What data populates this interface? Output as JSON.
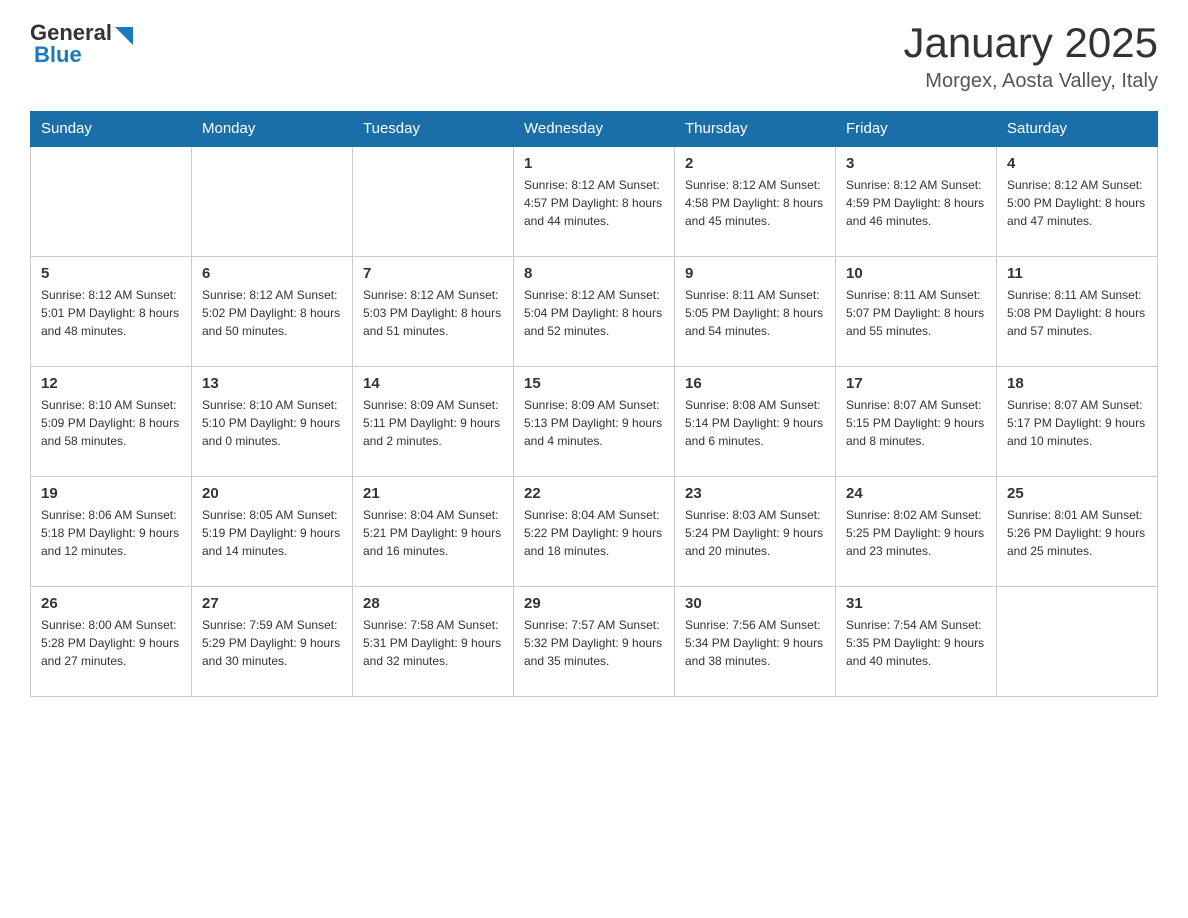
{
  "header": {
    "logo_general": "General",
    "logo_blue": "Blue",
    "title": "January 2025",
    "subtitle": "Morgex, Aosta Valley, Italy"
  },
  "days_of_week": [
    "Sunday",
    "Monday",
    "Tuesday",
    "Wednesday",
    "Thursday",
    "Friday",
    "Saturday"
  ],
  "weeks": [
    [
      {
        "day": "",
        "info": ""
      },
      {
        "day": "",
        "info": ""
      },
      {
        "day": "",
        "info": ""
      },
      {
        "day": "1",
        "info": "Sunrise: 8:12 AM\nSunset: 4:57 PM\nDaylight: 8 hours\nand 44 minutes."
      },
      {
        "day": "2",
        "info": "Sunrise: 8:12 AM\nSunset: 4:58 PM\nDaylight: 8 hours\nand 45 minutes."
      },
      {
        "day": "3",
        "info": "Sunrise: 8:12 AM\nSunset: 4:59 PM\nDaylight: 8 hours\nand 46 minutes."
      },
      {
        "day": "4",
        "info": "Sunrise: 8:12 AM\nSunset: 5:00 PM\nDaylight: 8 hours\nand 47 minutes."
      }
    ],
    [
      {
        "day": "5",
        "info": "Sunrise: 8:12 AM\nSunset: 5:01 PM\nDaylight: 8 hours\nand 48 minutes."
      },
      {
        "day": "6",
        "info": "Sunrise: 8:12 AM\nSunset: 5:02 PM\nDaylight: 8 hours\nand 50 minutes."
      },
      {
        "day": "7",
        "info": "Sunrise: 8:12 AM\nSunset: 5:03 PM\nDaylight: 8 hours\nand 51 minutes."
      },
      {
        "day": "8",
        "info": "Sunrise: 8:12 AM\nSunset: 5:04 PM\nDaylight: 8 hours\nand 52 minutes."
      },
      {
        "day": "9",
        "info": "Sunrise: 8:11 AM\nSunset: 5:05 PM\nDaylight: 8 hours\nand 54 minutes."
      },
      {
        "day": "10",
        "info": "Sunrise: 8:11 AM\nSunset: 5:07 PM\nDaylight: 8 hours\nand 55 minutes."
      },
      {
        "day": "11",
        "info": "Sunrise: 8:11 AM\nSunset: 5:08 PM\nDaylight: 8 hours\nand 57 minutes."
      }
    ],
    [
      {
        "day": "12",
        "info": "Sunrise: 8:10 AM\nSunset: 5:09 PM\nDaylight: 8 hours\nand 58 minutes."
      },
      {
        "day": "13",
        "info": "Sunrise: 8:10 AM\nSunset: 5:10 PM\nDaylight: 9 hours\nand 0 minutes."
      },
      {
        "day": "14",
        "info": "Sunrise: 8:09 AM\nSunset: 5:11 PM\nDaylight: 9 hours\nand 2 minutes."
      },
      {
        "day": "15",
        "info": "Sunrise: 8:09 AM\nSunset: 5:13 PM\nDaylight: 9 hours\nand 4 minutes."
      },
      {
        "day": "16",
        "info": "Sunrise: 8:08 AM\nSunset: 5:14 PM\nDaylight: 9 hours\nand 6 minutes."
      },
      {
        "day": "17",
        "info": "Sunrise: 8:07 AM\nSunset: 5:15 PM\nDaylight: 9 hours\nand 8 minutes."
      },
      {
        "day": "18",
        "info": "Sunrise: 8:07 AM\nSunset: 5:17 PM\nDaylight: 9 hours\nand 10 minutes."
      }
    ],
    [
      {
        "day": "19",
        "info": "Sunrise: 8:06 AM\nSunset: 5:18 PM\nDaylight: 9 hours\nand 12 minutes."
      },
      {
        "day": "20",
        "info": "Sunrise: 8:05 AM\nSunset: 5:19 PM\nDaylight: 9 hours\nand 14 minutes."
      },
      {
        "day": "21",
        "info": "Sunrise: 8:04 AM\nSunset: 5:21 PM\nDaylight: 9 hours\nand 16 minutes."
      },
      {
        "day": "22",
        "info": "Sunrise: 8:04 AM\nSunset: 5:22 PM\nDaylight: 9 hours\nand 18 minutes."
      },
      {
        "day": "23",
        "info": "Sunrise: 8:03 AM\nSunset: 5:24 PM\nDaylight: 9 hours\nand 20 minutes."
      },
      {
        "day": "24",
        "info": "Sunrise: 8:02 AM\nSunset: 5:25 PM\nDaylight: 9 hours\nand 23 minutes."
      },
      {
        "day": "25",
        "info": "Sunrise: 8:01 AM\nSunset: 5:26 PM\nDaylight: 9 hours\nand 25 minutes."
      }
    ],
    [
      {
        "day": "26",
        "info": "Sunrise: 8:00 AM\nSunset: 5:28 PM\nDaylight: 9 hours\nand 27 minutes."
      },
      {
        "day": "27",
        "info": "Sunrise: 7:59 AM\nSunset: 5:29 PM\nDaylight: 9 hours\nand 30 minutes."
      },
      {
        "day": "28",
        "info": "Sunrise: 7:58 AM\nSunset: 5:31 PM\nDaylight: 9 hours\nand 32 minutes."
      },
      {
        "day": "29",
        "info": "Sunrise: 7:57 AM\nSunset: 5:32 PM\nDaylight: 9 hours\nand 35 minutes."
      },
      {
        "day": "30",
        "info": "Sunrise: 7:56 AM\nSunset: 5:34 PM\nDaylight: 9 hours\nand 38 minutes."
      },
      {
        "day": "31",
        "info": "Sunrise: 7:54 AM\nSunset: 5:35 PM\nDaylight: 9 hours\nand 40 minutes."
      },
      {
        "day": "",
        "info": ""
      }
    ]
  ]
}
